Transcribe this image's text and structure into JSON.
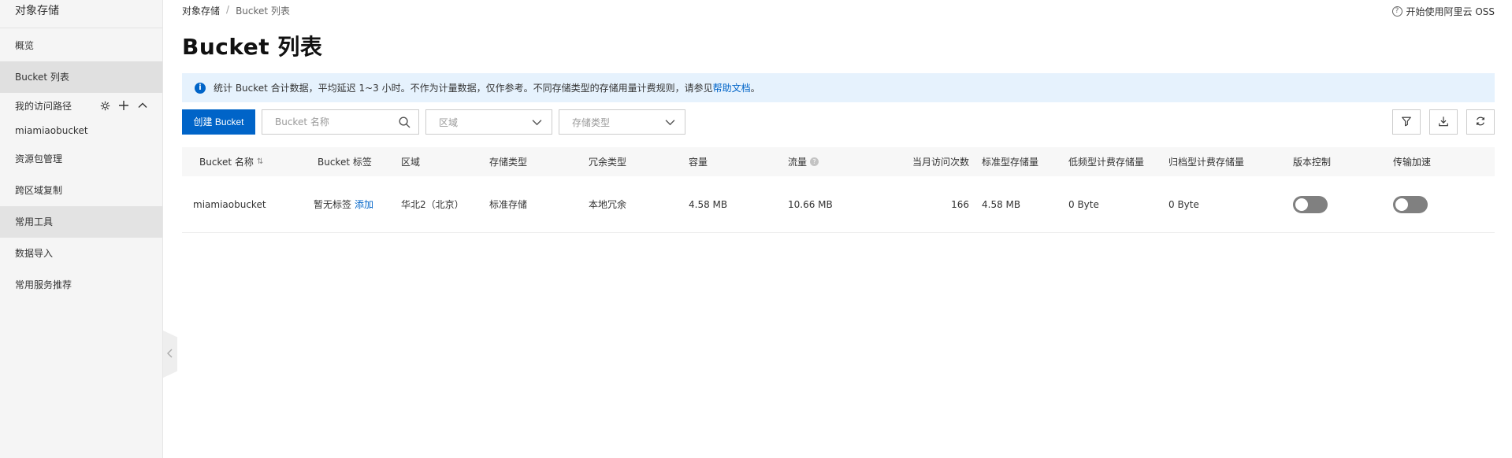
{
  "sidebar": {
    "title": "对象存储",
    "items": [
      {
        "label": "概览"
      },
      {
        "label": "Bucket 列表"
      }
    ],
    "access_path": {
      "label": "我的访问路径",
      "bucket": "miamiaobucket"
    },
    "tools": [
      {
        "label": "资源包管理"
      },
      {
        "label": "跨区域复制"
      },
      {
        "label": "常用工具"
      },
      {
        "label": "数据导入"
      },
      {
        "label": "常用服务推荐"
      }
    ]
  },
  "breadcrumb": {
    "root": "对象存储",
    "sep": "/",
    "current": "Bucket 列表"
  },
  "help": {
    "label": "开始使用阿里云 OSS"
  },
  "page_title": "Bucket 列表",
  "notice": {
    "text": "统计 Bucket 合计数据，平均延迟 1~3 小时。不作为计量数据，仅作参考。不同存储类型的存储用量计费规则，请参见",
    "link": "帮助文档",
    "end": "。"
  },
  "toolbar": {
    "create_label": "创建 Bucket",
    "search_placeholder": "Bucket 名称",
    "region_placeholder": "区域",
    "storage_placeholder": "存储类型"
  },
  "table": {
    "headers": {
      "name": "Bucket 名称",
      "tag": "Bucket 标签",
      "region": "区域",
      "storage": "存储类型",
      "redundancy": "冗余类型",
      "capacity": "容量",
      "traffic": "流量",
      "visits": "当月访问次数",
      "standard": "标准型存储量",
      "ia": "低频型计费存储量",
      "archive": "归档型计费存储量",
      "versioning": "版本控制",
      "acceleration": "传输加速"
    },
    "rows": [
      {
        "name": "miamiaobucket",
        "tag": "暂无标签",
        "tag_add": "添加",
        "region": "华北2（北京）",
        "storage": "标准存储",
        "redundancy": "本地冗余",
        "capacity": "4.58 MB",
        "traffic": "10.66 MB",
        "visits": "166",
        "standard": "4.58 MB",
        "ia": "0 Byte",
        "archive": "0 Byte",
        "versioning": false,
        "acceleration": false
      }
    ]
  },
  "colors": {
    "primary": "#0064c8",
    "notice_bg": "#e6f2fd",
    "sidebar_bg": "#f5f5f5",
    "toggle_off": "#808080"
  }
}
